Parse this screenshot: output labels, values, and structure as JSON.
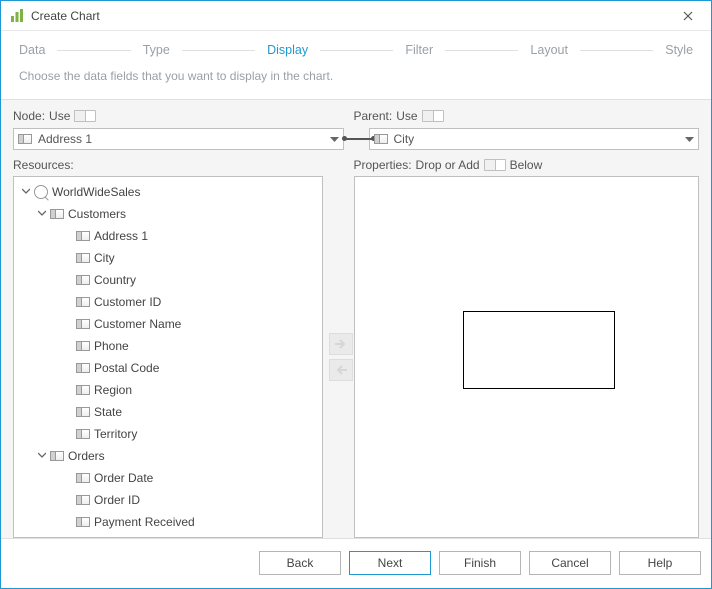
{
  "title": "Create Chart",
  "steps": {
    "data": "Data",
    "type": "Type",
    "display": "Display",
    "filter": "Filter",
    "layout": "Layout",
    "style": "Style"
  },
  "instruction": "Choose the data fields that you want to display in the chart.",
  "labels": {
    "node": "Node:",
    "parent": "Parent:",
    "use": "Use",
    "resources": "Resources:",
    "properties": "Properties:",
    "drop_or_add": "Drop or Add",
    "below": "Below"
  },
  "node_combo": "Address 1",
  "parent_combo": "City",
  "tree": [
    {
      "depth": 1,
      "expand": "down",
      "icon": "q",
      "label": "WorldWideSales"
    },
    {
      "depth": 2,
      "expand": "down",
      "icon": "folder",
      "label": "Customers"
    },
    {
      "depth": 3,
      "expand": "none",
      "icon": "field",
      "label": "Address 1"
    },
    {
      "depth": 3,
      "expand": "none",
      "icon": "field",
      "label": "City"
    },
    {
      "depth": 3,
      "expand": "none",
      "icon": "field",
      "label": "Country"
    },
    {
      "depth": 3,
      "expand": "none",
      "icon": "field",
      "label": "Customer ID"
    },
    {
      "depth": 3,
      "expand": "none",
      "icon": "field",
      "label": "Customer Name"
    },
    {
      "depth": 3,
      "expand": "none",
      "icon": "field",
      "label": "Phone"
    },
    {
      "depth": 3,
      "expand": "none",
      "icon": "field",
      "label": "Postal Code"
    },
    {
      "depth": 3,
      "expand": "none",
      "icon": "field",
      "label": "Region"
    },
    {
      "depth": 3,
      "expand": "none",
      "icon": "field",
      "label": "State"
    },
    {
      "depth": 3,
      "expand": "none",
      "icon": "field",
      "label": "Territory"
    },
    {
      "depth": 2,
      "expand": "down",
      "icon": "folder",
      "label": "Orders"
    },
    {
      "depth": 3,
      "expand": "none",
      "icon": "field",
      "label": "Order Date"
    },
    {
      "depth": 3,
      "expand": "none",
      "icon": "field",
      "label": "Order ID"
    },
    {
      "depth": 3,
      "expand": "none",
      "icon": "field",
      "label": "Payment Received"
    }
  ],
  "buttons": {
    "back": "Back",
    "next": "Next",
    "finish": "Finish",
    "cancel": "Cancel",
    "help": "Help"
  }
}
